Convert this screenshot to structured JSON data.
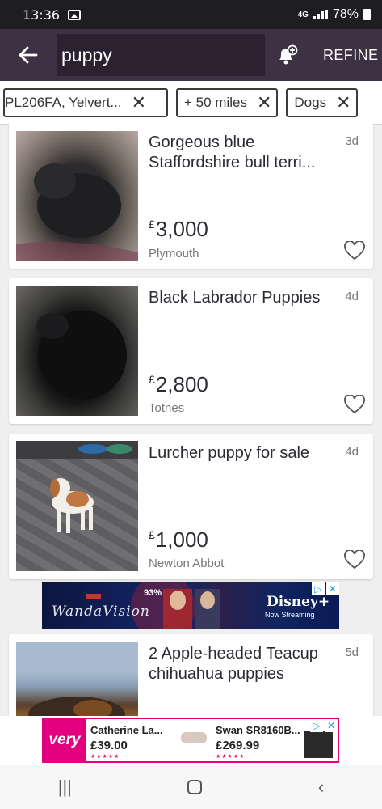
{
  "status": {
    "time": "13:36",
    "network": "4G",
    "battery": "78%"
  },
  "header": {
    "search_value": "puppy",
    "refine_label": "REFINE"
  },
  "filters": [
    {
      "label": "PL206FA, Yelvert..."
    },
    {
      "label": "+ 50 miles"
    },
    {
      "label": "Dogs"
    }
  ],
  "listings": [
    {
      "title": "Gorgeous blue Staffordshire bull terri...",
      "age": "3d",
      "price": "3,000",
      "location": "Plymouth"
    },
    {
      "title": "Black Labrador Puppies",
      "age": "4d",
      "price": "2,800",
      "location": "Totnes"
    },
    {
      "title": "Lurcher puppy for sale",
      "age": "4d",
      "price": "1,000",
      "location": "Newton Abbot"
    },
    {
      "title": "2 Apple-headed Teacup chihuahua puppies",
      "age": "5d",
      "price": "",
      "location": ""
    }
  ],
  "currency_symbol": "£",
  "ad_banner": {
    "badge": "93%",
    "show": "WandaVision",
    "brand": "Disney+",
    "cta": "Now Streaming"
  },
  "bottom_ad": {
    "brand": "very",
    "item1": {
      "name": "Catherine La...",
      "price": "£39.00"
    },
    "item2": {
      "name": "Swan SR8160B...",
      "price": "£269.99"
    }
  },
  "colors": {
    "header_bg": "#3c3244",
    "accent": "#e3007e"
  }
}
